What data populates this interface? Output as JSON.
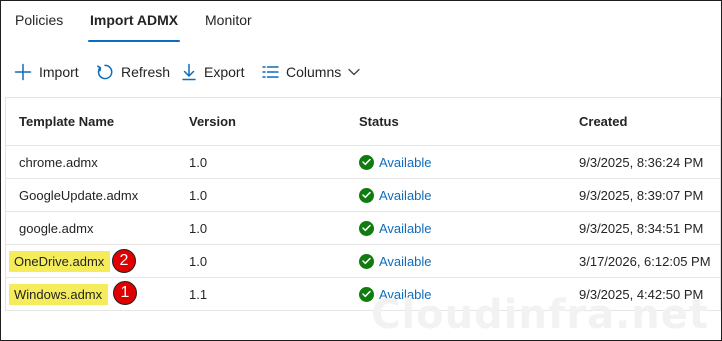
{
  "tabs": [
    {
      "label": "Policies",
      "active": false
    },
    {
      "label": "Import ADMX",
      "active": true
    },
    {
      "label": "Monitor",
      "active": false
    }
  ],
  "toolbar": {
    "import_label": "Import",
    "refresh_label": "Refresh",
    "export_label": "Export",
    "columns_label": "Columns"
  },
  "table": {
    "columns": [
      "Template Name",
      "Version",
      "Status",
      "Created"
    ],
    "rows": [
      {
        "name": "chrome.admx",
        "version": "1.0",
        "status": "Available",
        "created": "9/3/2025, 8:36:24 PM",
        "highlight": false
      },
      {
        "name": "GoogleUpdate.admx",
        "version": "1.0",
        "status": "Available",
        "created": "9/3/2025, 8:39:07 PM",
        "highlight": false
      },
      {
        "name": "google.admx",
        "version": "1.0",
        "status": "Available",
        "created": "9/3/2025, 8:34:51 PM",
        "highlight": false
      },
      {
        "name": "OneDrive.admx",
        "version": "1.0",
        "status": "Available",
        "created": "3/17/2026, 6:12:05 PM",
        "highlight": true,
        "badge": "2"
      },
      {
        "name": "Windows.admx",
        "version": "1.1",
        "status": "Available",
        "created": "9/3/2025, 4:42:50 PM",
        "highlight": true,
        "badge": "1"
      }
    ]
  },
  "watermark": "Cloudinfra.net",
  "colors": {
    "accent": "#0f6cbd",
    "success": "#107c10",
    "highlight": "#f5ec5c",
    "badge": "#e00000"
  }
}
